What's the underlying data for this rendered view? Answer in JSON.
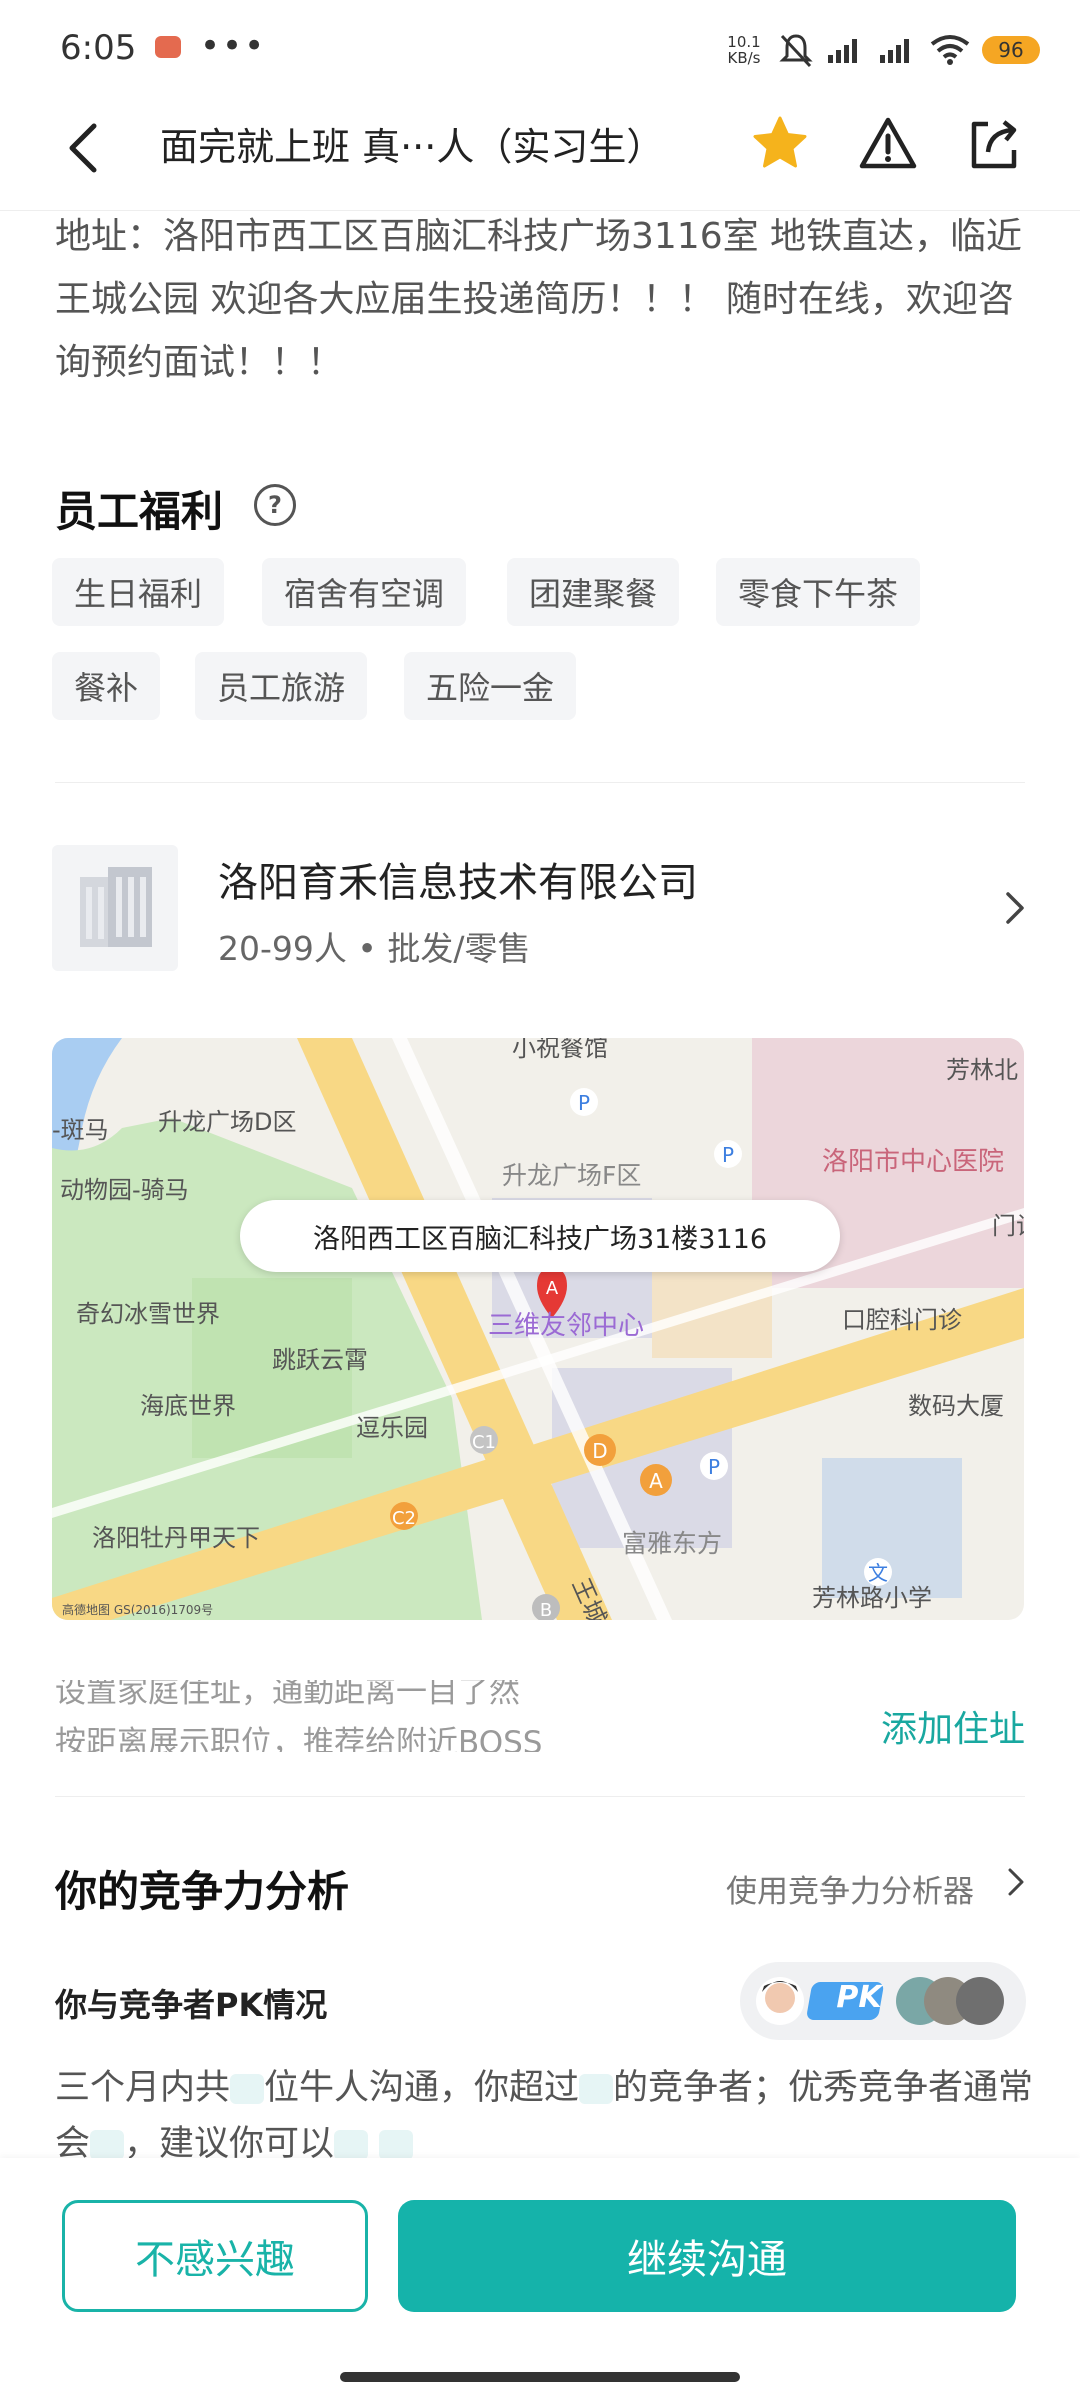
{
  "status_bar": {
    "time": "6:05",
    "dots": "•••",
    "speed": "10.1",
    "speed_unit": "KB/s",
    "battery": "96"
  },
  "header": {
    "title": "面完就上班 真···人（实习生）",
    "star_color": "#f5b31c"
  },
  "address": {
    "text": "地址：洛阳市西工区百脑汇科技广场3116室 地铁直达，临近王城公园 欢迎各大应届生投递简历！！！ 随时在线，欢迎咨询预约面试！！！"
  },
  "benefits": {
    "title": "员工福利",
    "help": "?",
    "tags": [
      "生日福利",
      "宿舍有空调",
      "团建聚餐",
      "零食下午茶",
      "餐补",
      "员工旅游",
      "五险一金"
    ]
  },
  "company": {
    "name": "洛阳育禾信息技术有限公司",
    "meta": "20-99人 • 批发/零售"
  },
  "map": {
    "bubble": "洛阳西工区百脑汇科技广场31楼3116",
    "marker": "A",
    "labels": {
      "top_restaurant": "小祝餐馆",
      "fanglin_north": "芳林北",
      "shenglong_d": "升龙广场D区",
      "banma": "-斑马",
      "hospital": "洛阳市中心医院",
      "zoo": "动物园-骑马",
      "shenglong_f": "升龙广场F区",
      "menzhen": "门诊",
      "ice_world": "奇幻冰雪世界",
      "sanwei": "三维友邻中心",
      "dental": "口腔科门诊",
      "yueyue": "跳跃云霄",
      "ocean": "海底世界",
      "shuma": "数码大厦",
      "doule": "逗乐园",
      "peony": "洛阳牡丹甲天下",
      "fuya": "富雅东方",
      "wangcheng": "王城大",
      "school": "芳林路小学",
      "copyright": "高德地图 GS(2016)1709号",
      "c1": "C1",
      "c2": "C2",
      "d": "D",
      "a": "A",
      "b": "B",
      "p": "P",
      "wen": "文"
    }
  },
  "commute": {
    "hint1": "设置家庭住址，通勤距离一目了然",
    "hint2": "按距离展示职位，推荐给附近BOSS",
    "add_button": "添加住址"
  },
  "competition": {
    "title": "你的竞争力分析",
    "tool_link": "使用竞争力分析器",
    "pk_label": "你与竞争者PK情况",
    "pk_badge": "PK",
    "text_a": "三个月内共",
    "text_b": "位牛人沟通，你超过",
    "text_c": "的竞争者；优秀竞争者通常会",
    "text_d": "，建议你可以"
  },
  "actions": {
    "not_interested": "不感兴趣",
    "continue_chat": "继续沟通"
  }
}
